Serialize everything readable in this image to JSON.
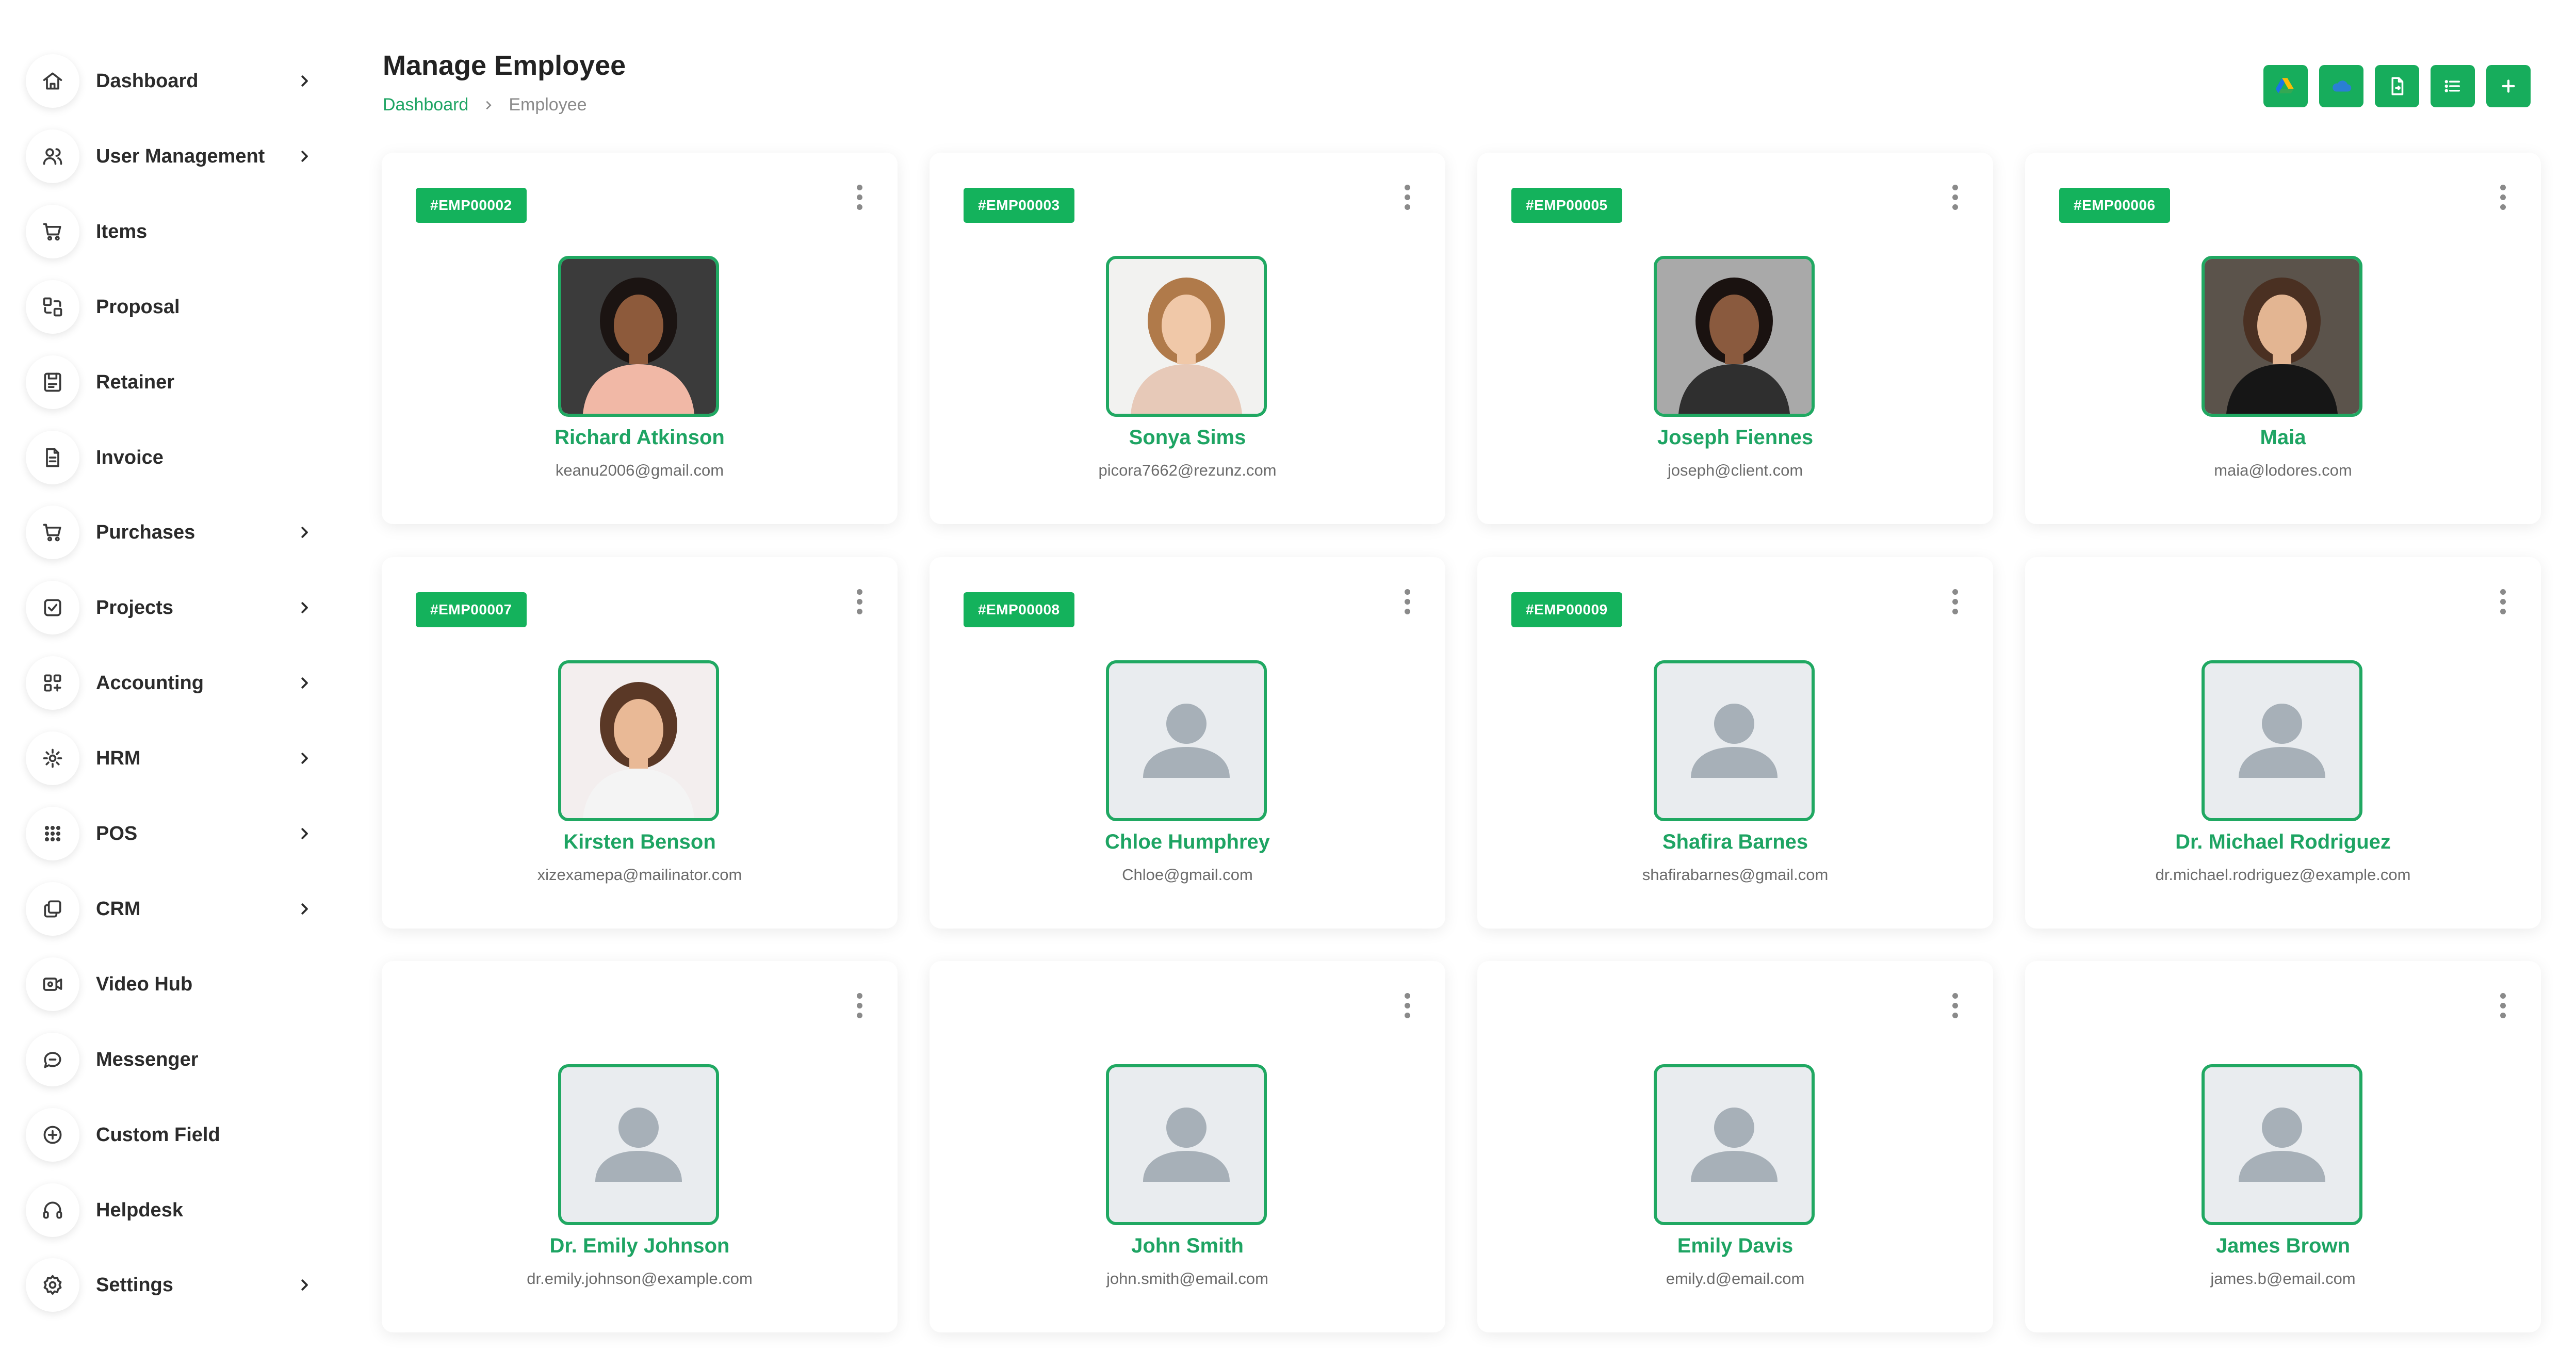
{
  "page": {
    "title": "Manage Employee",
    "breadcrumb": {
      "home": "Dashboard",
      "current": "Employee"
    }
  },
  "sidebar": {
    "items": [
      {
        "label": "Dashboard",
        "icon": "home-icon",
        "chevron": true
      },
      {
        "label": "User Management",
        "icon": "users-icon",
        "chevron": true
      },
      {
        "label": "Items",
        "icon": "cart-icon",
        "chevron": false
      },
      {
        "label": "Proposal",
        "icon": "proposal-icon",
        "chevron": false
      },
      {
        "label": "Retainer",
        "icon": "retainer-icon",
        "chevron": false
      },
      {
        "label": "Invoice",
        "icon": "invoice-icon",
        "chevron": false
      },
      {
        "label": "Purchases",
        "icon": "cart-icon",
        "chevron": true
      },
      {
        "label": "Projects",
        "icon": "checkbox-icon",
        "chevron": true
      },
      {
        "label": "Accounting",
        "icon": "grid-icon",
        "chevron": true
      },
      {
        "label": "HRM",
        "icon": "hrm-icon",
        "chevron": true
      },
      {
        "label": "POS",
        "icon": "dots-grid-icon",
        "chevron": true
      },
      {
        "label": "CRM",
        "icon": "crm-icon",
        "chevron": true
      },
      {
        "label": "Video Hub",
        "icon": "video-icon",
        "chevron": false
      },
      {
        "label": "Messenger",
        "icon": "chat-icon",
        "chevron": false
      },
      {
        "label": "Custom Field",
        "icon": "plus-circle-icon",
        "chevron": false
      },
      {
        "label": "Helpdesk",
        "icon": "headset-icon",
        "chevron": false
      },
      {
        "label": "Settings",
        "icon": "gear-icon",
        "chevron": true
      }
    ]
  },
  "toolbar": {
    "buttons": [
      "google-drive-icon",
      "onedrive-icon",
      "file-export-icon",
      "list-view-icon",
      "add-icon"
    ]
  },
  "theme": {
    "accent": "#17ad5c",
    "accent_text": "#1ea463"
  },
  "employees": [
    {
      "id": "#EMP00002",
      "name": "Richard Atkinson",
      "email": "keanu2006@gmail.com",
      "photo": "photo"
    },
    {
      "id": "#EMP00003",
      "name": "Sonya Sims",
      "email": "picora7662@rezunz.com",
      "photo": "photo"
    },
    {
      "id": "#EMP00005",
      "name": "Joseph Fiennes",
      "email": "joseph@client.com",
      "photo": "photo"
    },
    {
      "id": "#EMP00006",
      "name": "Maia",
      "email": "maia@lodores.com",
      "photo": "photo"
    },
    {
      "id": "#EMP00007",
      "name": "Kirsten Benson",
      "email": "xizexamepa@mailinator.com",
      "photo": "photo"
    },
    {
      "id": "#EMP00008",
      "name": "Chloe Humphrey",
      "email": "Chloe@gmail.com",
      "photo": "placeholder"
    },
    {
      "id": "#EMP00009",
      "name": "Shafira Barnes",
      "email": "shafirabarnes@gmail.com",
      "photo": "placeholder"
    },
    {
      "id": "",
      "name": "Dr. Michael Rodriguez",
      "email": "dr.michael.rodriguez@example.com",
      "photo": "placeholder"
    },
    {
      "id": "",
      "name": "Dr. Emily Johnson",
      "email": "dr.emily.johnson@example.com",
      "photo": "placeholder"
    },
    {
      "id": "",
      "name": "John Smith",
      "email": "john.smith@email.com",
      "photo": "placeholder"
    },
    {
      "id": "",
      "name": "Emily Davis",
      "email": "emily.d@email.com",
      "photo": "placeholder"
    },
    {
      "id": "",
      "name": "James Brown",
      "email": "james.b@email.com",
      "photo": "placeholder"
    }
  ]
}
